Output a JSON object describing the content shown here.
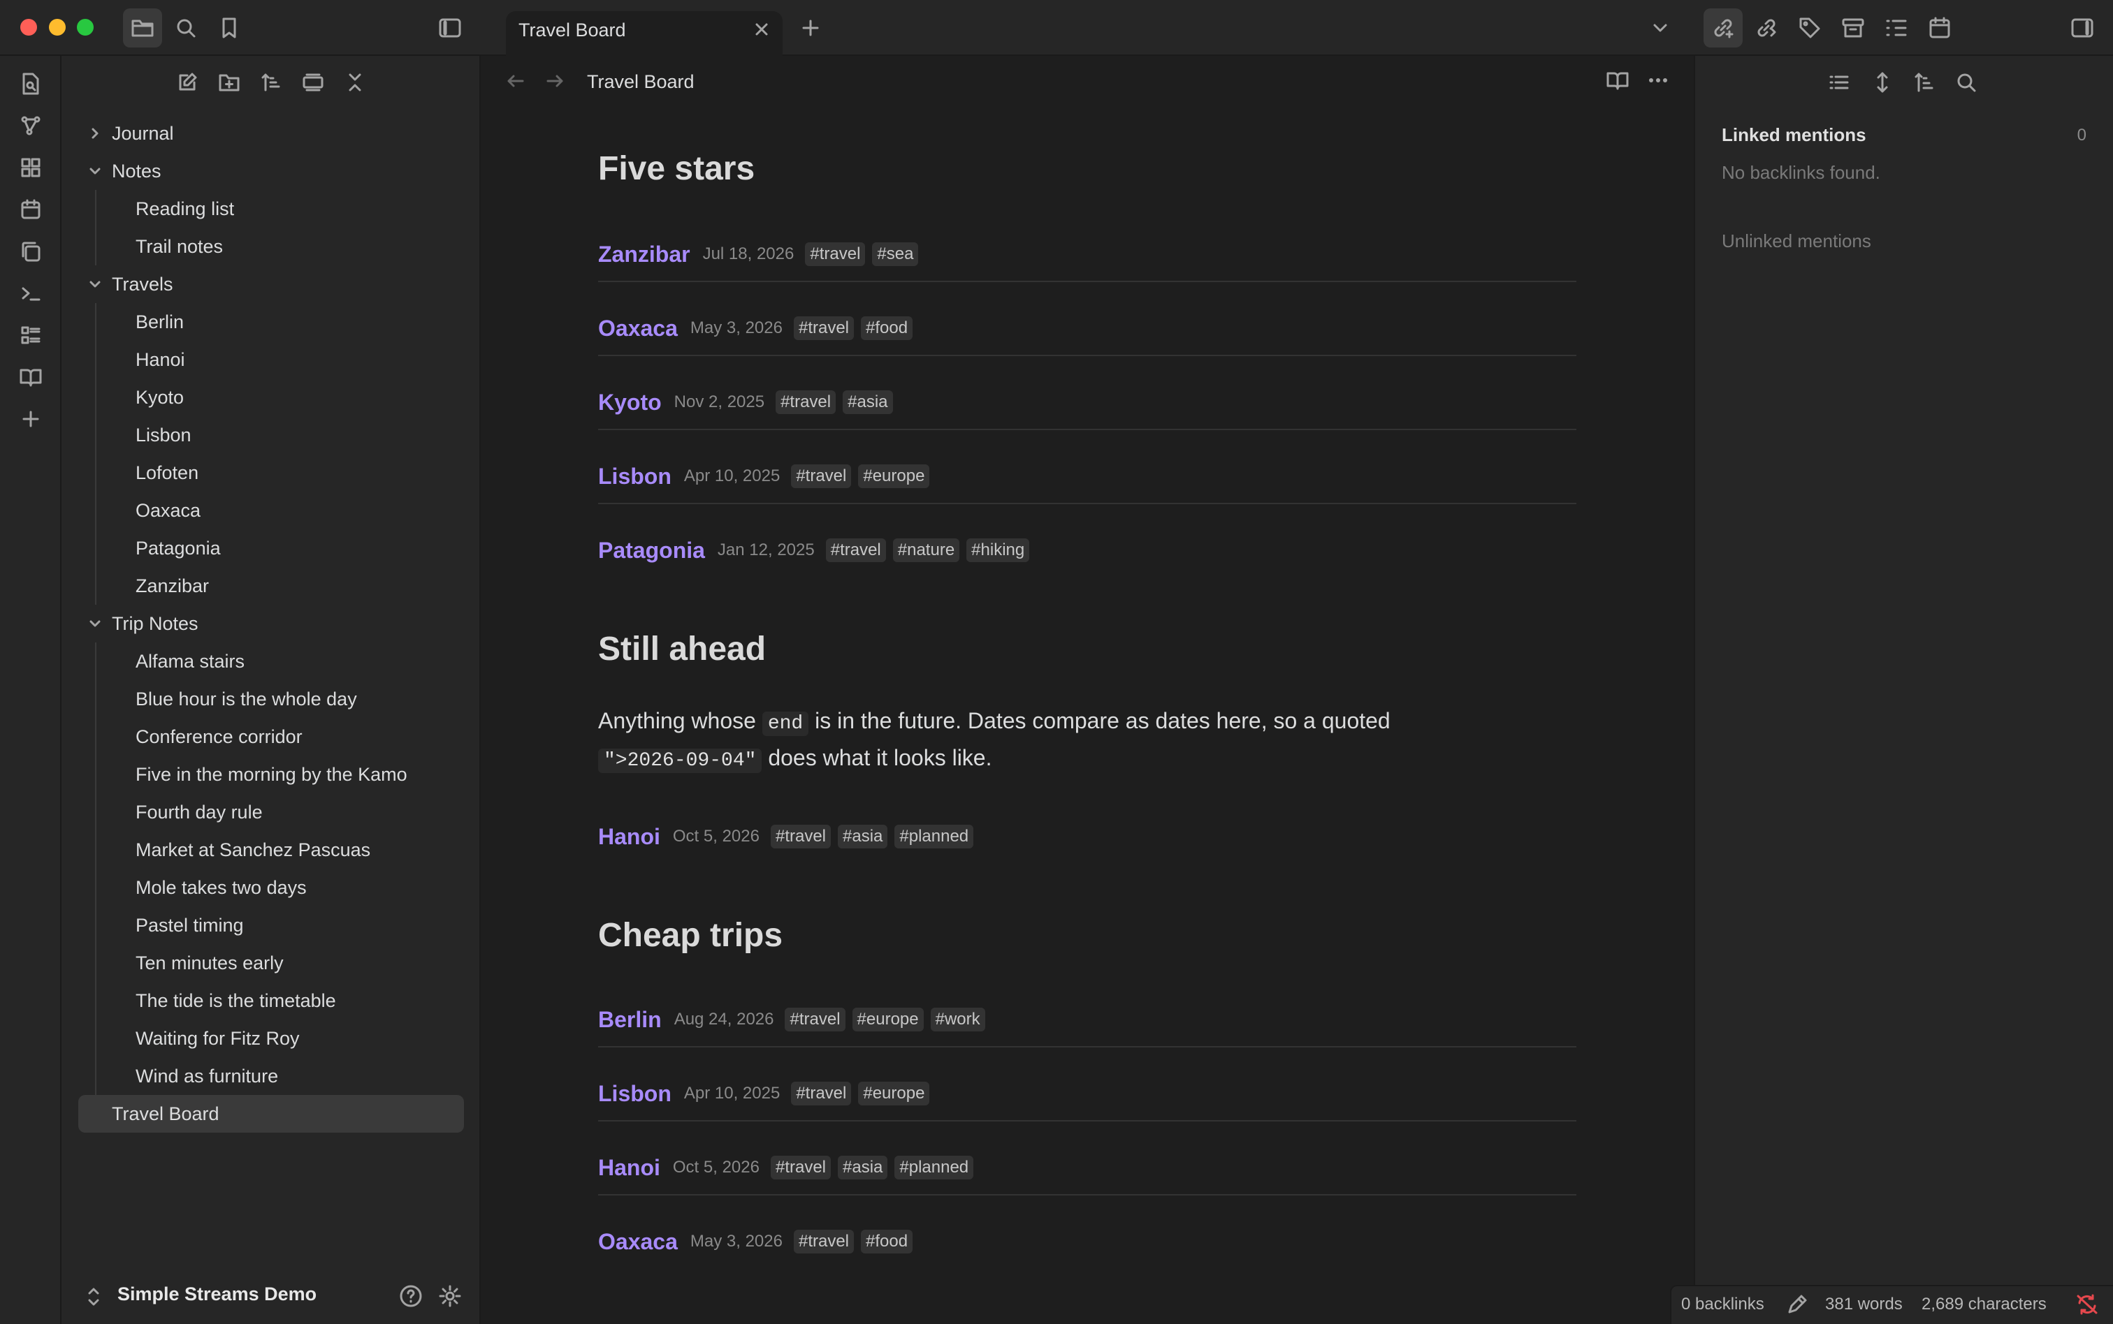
{
  "tab": {
    "title": "Travel Board"
  },
  "breadcrumb": {
    "title": "Travel Board"
  },
  "sidebar": {
    "folders": [
      {
        "name": "Journal",
        "expanded": false
      },
      {
        "name": "Notes",
        "expanded": true,
        "files": [
          "Reading list",
          "Trail notes"
        ]
      },
      {
        "name": "Travels",
        "expanded": true,
        "files": [
          "Berlin",
          "Hanoi",
          "Kyoto",
          "Lisbon",
          "Lofoten",
          "Oaxaca",
          "Patagonia",
          "Zanzibar"
        ]
      },
      {
        "name": "Trip Notes",
        "expanded": true,
        "files": [
          "Alfama stairs",
          "Blue hour is the whole day",
          "Conference corridor",
          "Five in the morning by the Kamo",
          "Fourth day rule",
          "Market at Sanchez Pascuas",
          "Mole takes two days",
          "Pastel timing",
          "Ten minutes early",
          "The tide is the timetable",
          "Waiting for Fitz Roy",
          "Wind as furniture"
        ]
      }
    ],
    "root_file": "Travel Board",
    "vault_name": "Simple Streams Demo"
  },
  "content": {
    "five_stars": {
      "heading": "Five stars",
      "entries": [
        {
          "name": "Zanzibar",
          "date": "Jul 18, 2026",
          "tags": [
            "#travel",
            "#sea"
          ]
        },
        {
          "name": "Oaxaca",
          "date": "May 3, 2026",
          "tags": [
            "#travel",
            "#food"
          ]
        },
        {
          "name": "Kyoto",
          "date": "Nov 2, 2025",
          "tags": [
            "#travel",
            "#asia"
          ]
        },
        {
          "name": "Lisbon",
          "date": "Apr 10, 2025",
          "tags": [
            "#travel",
            "#europe"
          ]
        },
        {
          "name": "Patagonia",
          "date": "Jan 12, 2025",
          "tags": [
            "#travel",
            "#nature",
            "#hiking"
          ]
        }
      ]
    },
    "still_ahead": {
      "heading": "Still ahead",
      "para_1": "Anything whose",
      "code_1": "end",
      "para_2": "is in the future. Dates compare as dates here, so a quoted",
      "code_2": "\">2026-09-04\"",
      "para_3": "does what it looks like.",
      "entries": [
        {
          "name": "Hanoi",
          "date": "Oct 5, 2026",
          "tags": [
            "#travel",
            "#asia",
            "#planned"
          ]
        }
      ]
    },
    "cheap_trips": {
      "heading": "Cheap trips",
      "entries": [
        {
          "name": "Berlin",
          "date": "Aug 24, 2026",
          "tags": [
            "#travel",
            "#europe",
            "#work"
          ]
        },
        {
          "name": "Lisbon",
          "date": "Apr 10, 2025",
          "tags": [
            "#travel",
            "#europe"
          ]
        },
        {
          "name": "Hanoi",
          "date": "Oct 5, 2026",
          "tags": [
            "#travel",
            "#asia",
            "#planned"
          ]
        },
        {
          "name": "Oaxaca",
          "date": "May 3, 2026",
          "tags": [
            "#travel",
            "#food"
          ]
        }
      ]
    }
  },
  "right_panel": {
    "linked_title": "Linked mentions",
    "linked_count": "0",
    "no_backlinks": "No backlinks found.",
    "unlinked_title": "Unlinked mentions"
  },
  "status_bar": {
    "backlinks": "0 backlinks",
    "words": "381 words",
    "characters": "2,689 characters"
  },
  "colors": {
    "accent": "#a88bfa",
    "background": "#1e1e1e",
    "panel": "#262626",
    "traffic_red": "#ff5f57",
    "traffic_yellow": "#febc2e",
    "traffic_green": "#28c840",
    "sync_error": "#e5484d"
  }
}
